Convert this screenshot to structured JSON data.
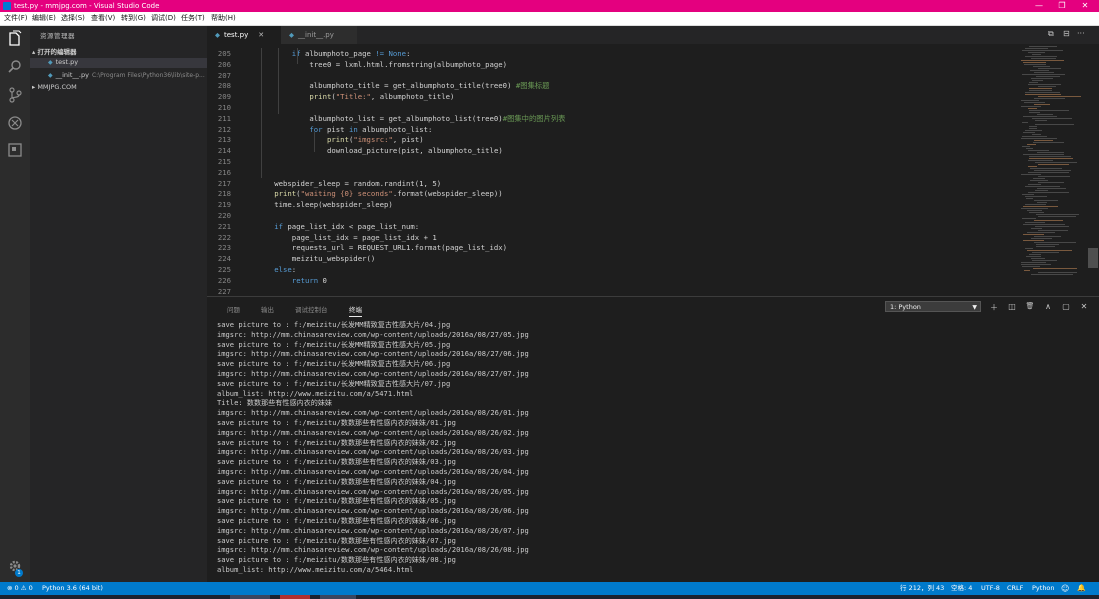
{
  "window": {
    "title": "test.py - mmjpg.com - Visual Studio Code",
    "buttons": {
      "minimize": "—",
      "restore": "❐",
      "close": "✕"
    }
  },
  "menu": [
    "文件(F)",
    "编辑(E)",
    "选择(S)",
    "查看(V)",
    "转到(G)",
    "调试(D)",
    "任务(T)",
    "帮助(H)"
  ],
  "activity_bar": [
    "files-icon",
    "search-icon",
    "source-control-icon",
    "debug-icon",
    "extensions-icon",
    "settings-gear-icon"
  ],
  "activity_badge": "1",
  "sidebar": {
    "header": "资源管理器",
    "open_editors_label": "▴ 打开的编辑器",
    "open_files": [
      {
        "name": "test.py",
        "path": ""
      },
      {
        "name": "__init__.py",
        "path": "C:\\Program Files\\Python36\\lib\\site-p..."
      }
    ],
    "workspace_label": "▸ MMJPG.COM"
  },
  "tabs": [
    {
      "label": "test.py",
      "close": "✕"
    },
    {
      "label": "__init__.py"
    }
  ],
  "editor_actions": [
    "⧉",
    "⊟",
    "···"
  ],
  "editor": {
    "lines": [
      {
        "num": "205",
        "indent": 6,
        "parts": [
          [
            "kw",
            "if"
          ],
          [
            "t",
            " albumphoto_page "
          ],
          [
            "kw",
            "!="
          ],
          [
            "t",
            " "
          ],
          [
            "kw",
            "None"
          ],
          [
            "t",
            ":"
          ]
        ]
      },
      {
        "num": "206",
        "indent": 8,
        "parts": [
          [
            "t",
            "tree0 = lxml.html.fromstring(albumphoto_page)"
          ]
        ]
      },
      {
        "num": "207",
        "indent": 0,
        "parts": []
      },
      {
        "num": "208",
        "indent": 8,
        "parts": [
          [
            "t",
            "albumphoto_title = get_albumphoto_title(tree0) "
          ],
          [
            "cm",
            "#图集标题"
          ]
        ]
      },
      {
        "num": "209",
        "indent": 8,
        "parts": [
          [
            "fn",
            "print"
          ],
          [
            "t",
            "("
          ],
          [
            "str",
            "\"Title:\""
          ],
          [
            "t",
            ", albumphoto_title)"
          ]
        ]
      },
      {
        "num": "210",
        "indent": 0,
        "parts": []
      },
      {
        "num": "211",
        "indent": 8,
        "parts": [
          [
            "t",
            "albumphoto_list = get_albumphoto_list(tree0)"
          ],
          [
            "cm",
            "#图集中的图片列表"
          ]
        ]
      },
      {
        "num": "212",
        "indent": 8,
        "parts": [
          [
            "kw",
            "for"
          ],
          [
            "t",
            " pi"
          ],
          [
            "t",
            "st "
          ],
          [
            "kw",
            "in"
          ],
          [
            "t",
            " albumphoto_list:"
          ]
        ]
      },
      {
        "num": "213",
        "indent": 10,
        "parts": [
          [
            "fn",
            "print"
          ],
          [
            "t",
            "("
          ],
          [
            "str",
            "\"imgsrc:\""
          ],
          [
            "t",
            ", pist)"
          ]
        ]
      },
      {
        "num": "214",
        "indent": 10,
        "parts": [
          [
            "t",
            "download_picture(pist, albumphoto_title)"
          ]
        ]
      },
      {
        "num": "215",
        "indent": 0,
        "parts": []
      },
      {
        "num": "216",
        "indent": 0,
        "parts": []
      },
      {
        "num": "217",
        "indent": 4,
        "parts": [
          [
            "t",
            "webspider_sleep = random.randint(1, 5)"
          ]
        ]
      },
      {
        "num": "218",
        "indent": 4,
        "parts": [
          [
            "fn",
            "print"
          ],
          [
            "t",
            "("
          ],
          [
            "str",
            "\"waiting {0} seconds\""
          ],
          [
            "t",
            ".format(webspider_sleep))"
          ]
        ]
      },
      {
        "num": "219",
        "indent": 4,
        "parts": [
          [
            "t",
            "time.sleep(webspider_sleep)"
          ]
        ]
      },
      {
        "num": "220",
        "indent": 0,
        "parts": []
      },
      {
        "num": "221",
        "indent": 4,
        "parts": [
          [
            "kw",
            "if"
          ],
          [
            "t",
            " page_list_idx < page_list_num:"
          ]
        ]
      },
      {
        "num": "222",
        "indent": 6,
        "parts": [
          [
            "t",
            "page_list_idx = page_list_idx + 1"
          ]
        ]
      },
      {
        "num": "223",
        "indent": 6,
        "parts": [
          [
            "t",
            "requests_url = REQUEST_URL1.format(page_list_idx)"
          ]
        ]
      },
      {
        "num": "224",
        "indent": 6,
        "parts": [
          [
            "t",
            "meizitu_webspider()"
          ]
        ]
      },
      {
        "num": "225",
        "indent": 4,
        "parts": [
          [
            "kw",
            "else"
          ],
          [
            "t",
            ":"
          ]
        ]
      },
      {
        "num": "226",
        "indent": 6,
        "parts": [
          [
            "kw",
            "return"
          ],
          [
            "t",
            " 0"
          ]
        ]
      },
      {
        "num": "227",
        "indent": 0,
        "parts": []
      }
    ]
  },
  "panel": {
    "tabs": [
      "问题",
      "输出",
      "调试控制台",
      "终端"
    ],
    "active_tab": "终端",
    "terminal_select": "1: Python",
    "actions": [
      "＋",
      "◫",
      "🗑",
      "∧",
      "▢",
      "✕"
    ],
    "terminal_lines": [
      "save picture to : f:/meizitu/长发MM精致复古性感大片/04.jpg",
      "imgsrc: http://mm.chinasareview.com/wp-content/uploads/2016a/08/27/05.jpg",
      "save picture to : f:/meizitu/长发MM精致复古性感大片/05.jpg",
      "imgsrc: http://mm.chinasareview.com/wp-content/uploads/2016a/08/27/06.jpg",
      "save picture to : f:/meizitu/长发MM精致复古性感大片/06.jpg",
      "imgsrc: http://mm.chinasareview.com/wp-content/uploads/2016a/08/27/07.jpg",
      "save picture to : f:/meizitu/长发MM精致复古性感大片/07.jpg",
      "album_list: http://www.meizitu.com/a/5471.html",
      "Title: 数数那些有性感内衣的妹妹",
      "imgsrc: http://mm.chinasareview.com/wp-content/uploads/2016a/08/26/01.jpg",
      "save picture to : f:/meizitu/数数那些有性感内衣的妹妹/01.jpg",
      "imgsrc: http://mm.chinasareview.com/wp-content/uploads/2016a/08/26/02.jpg",
      "save picture to : f:/meizitu/数数那些有性感内衣的妹妹/02.jpg",
      "imgsrc: http://mm.chinasareview.com/wp-content/uploads/2016a/08/26/03.jpg",
      "save picture to : f:/meizitu/数数那些有性感内衣的妹妹/03.jpg",
      "imgsrc: http://mm.chinasareview.com/wp-content/uploads/2016a/08/26/04.jpg",
      "save picture to : f:/meizitu/数数那些有性感内衣的妹妹/04.jpg",
      "imgsrc: http://mm.chinasareview.com/wp-content/uploads/2016a/08/26/05.jpg",
      "save picture to : f:/meizitu/数数那些有性感内衣的妹妹/05.jpg",
      "imgsrc: http://mm.chinasareview.com/wp-content/uploads/2016a/08/26/06.jpg",
      "save picture to : f:/meizitu/数数那些有性感内衣的妹妹/06.jpg",
      "imgsrc: http://mm.chinasareview.com/wp-content/uploads/2016a/08/26/07.jpg",
      "save picture to : f:/meizitu/数数那些有性感内衣的妹妹/07.jpg",
      "imgsrc: http://mm.chinasareview.com/wp-content/uploads/2016a/08/26/08.jpg",
      "save picture to : f:/meizitu/数数那些有性感内衣的妹妹/08.jpg",
      "album_list: http://www.meizitu.com/a/5464.html"
    ]
  },
  "status": {
    "problems": "⊗ 0 ⚠ 0",
    "interpreter": "Python 3.6 (64 bit)",
    "position": "行 212，列 43",
    "spaces": "空格: 4",
    "encoding": "UTF-8",
    "eol": "CRLF",
    "language": "Python",
    "feedback_icon": "☺",
    "bell_icon": "🔔"
  },
  "colors": {
    "titlebar": "#e4007f",
    "statusbar": "#007acc",
    "editor_bg": "#1e1e1e",
    "sidebar_bg": "#252526"
  }
}
